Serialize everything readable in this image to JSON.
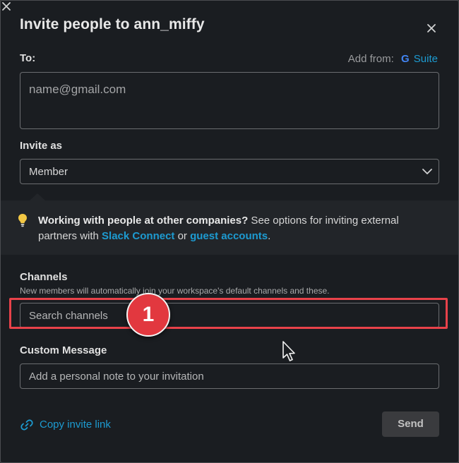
{
  "dialog": {
    "title": "Invite people to ann_miffy"
  },
  "to": {
    "label": "To:",
    "add_from_label": "Add from:",
    "add_from_g": "G",
    "add_from_suite": "Suite",
    "placeholder": "name@gmail.com"
  },
  "invite_as": {
    "label": "Invite as",
    "selected": "Member"
  },
  "banner": {
    "bold_text": "Working with people at other companies?",
    "text_1": " See options for inviting external partners with ",
    "link_1": "Slack Connect",
    "text_2": " or ",
    "link_2": "guest accounts",
    "text_3": "."
  },
  "channels": {
    "label": "Channels",
    "hint": "New members will automatically join your workspace's default channels and these.",
    "placeholder": "Search channels"
  },
  "annotation": {
    "step_number": "1",
    "highlight_color": "#e8424a"
  },
  "custom_message": {
    "label": "Custom Message",
    "placeholder": "Add a personal note to your invitation"
  },
  "footer": {
    "copy_link_label": "Copy invite link",
    "send_label": "Send"
  },
  "colors": {
    "background": "#1a1d21",
    "link": "#1d9bd1",
    "banner": "#222529",
    "bulb": "#f2c744"
  },
  "icons": {
    "close": "close-icon",
    "chevron": "chevron-down-icon",
    "bulb": "lightbulb-icon",
    "link": "link-icon",
    "google": "google-g-icon",
    "cursor": "mouse-pointer-icon"
  }
}
